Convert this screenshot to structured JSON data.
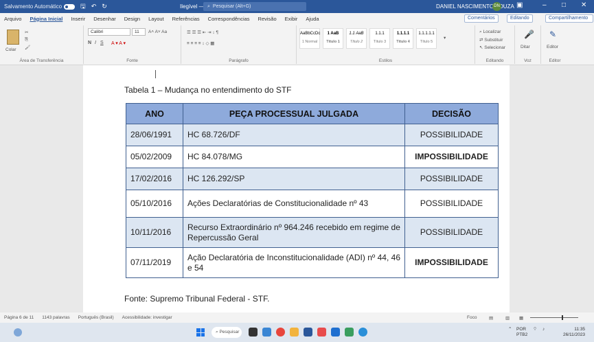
{
  "titlebar": {
    "autosave_label": "Salvamento Automático",
    "doc_title": "Ilegível — ARGO...",
    "search_placeholder": "Pesquisar (Alt+G)",
    "user_name": "DANIEL NASCIMENTO SOUZA",
    "avatar_initials": "DN"
  },
  "menu": {
    "tabs": [
      "Arquivo",
      "Página Inicial",
      "Inserir",
      "Desenhar",
      "Design",
      "Layout",
      "Referências",
      "Correspondências",
      "Revisão",
      "Exibir",
      "Ajuda"
    ],
    "comments": "Comentários",
    "editing": "Editando",
    "share": "Compartilhamento"
  },
  "ribbon": {
    "clipboard_label": "Área de Transferência",
    "paste": "Colar",
    "font_label": "Fonte",
    "paragraph_label": "Parágrafo",
    "styles_label": "Estilos",
    "editing_label": "Editando",
    "voice_label": "Voz",
    "editor_label": "Editor",
    "font_name": "Calibri",
    "font_size": "11",
    "styles": [
      {
        "sample": "AaBbCcDc",
        "name": "1 Normal"
      },
      {
        "sample": "1 AaB",
        "name": "Título 1"
      },
      {
        "sample": "1.1 AaB",
        "name": "Título 2"
      },
      {
        "sample": "1.1.1",
        "name": "Título 3"
      },
      {
        "sample": "1.1.1.1",
        "name": "Título 4"
      },
      {
        "sample": "1.1.1.1.1",
        "name": "Título 5"
      }
    ],
    "find": "Localizar",
    "replace": "Substituir",
    "select": "Selecionar",
    "dictate": "Ditar",
    "editor": "Editor"
  },
  "document": {
    "caption": "Tabela 1 – Mudança no entendimento do STF",
    "headers": [
      "ANO",
      "PEÇA PROCESSUAL JULGADA",
      "DECISÃO"
    ],
    "rows": [
      {
        "date": "28/06/1991",
        "piece": "HC 68.726/DF",
        "decision": "POSSIBILIDADE",
        "bold": false
      },
      {
        "date": "05/02/2009",
        "piece": "HC 84.078/MG",
        "decision": "IMPOSSIBILIDADE",
        "bold": true
      },
      {
        "date": "17/02/2016",
        "piece": "HC 126.292/SP",
        "decision": "POSSIBILIDADE",
        "bold": false
      },
      {
        "date": "05/10/2016",
        "piece": "Ações Declaratórias de Constitucionalidade nº 43",
        "decision": "POSSIBILIDADE",
        "bold": false
      },
      {
        "date": "10/11/2016",
        "piece": "Recurso Extraordinário nº 964.246 recebido em regime de Repercussão Geral",
        "decision": "POSSIBILIDADE",
        "bold": false
      },
      {
        "date": "07/11/2019",
        "piece": "Ação Declaratória de Inconstitucionalidade (ADI) nº 44, 46 e 54",
        "decision": "IMPOSSIBILIDADE",
        "bold": true
      }
    ],
    "source": "Fonte: Supremo Tribunal Federal - STF."
  },
  "status": {
    "page": "Página 6 de 11",
    "words": "1143 palavras",
    "language": "Português (Brasil)",
    "accessibility": "Acessibilidade: investigar",
    "focus": "Foco"
  },
  "taskbar": {
    "search": "Pesquisar",
    "lang_top": "POR",
    "lang_bottom": "PTB2",
    "time": "11:35",
    "date": "26/11/2023"
  }
}
